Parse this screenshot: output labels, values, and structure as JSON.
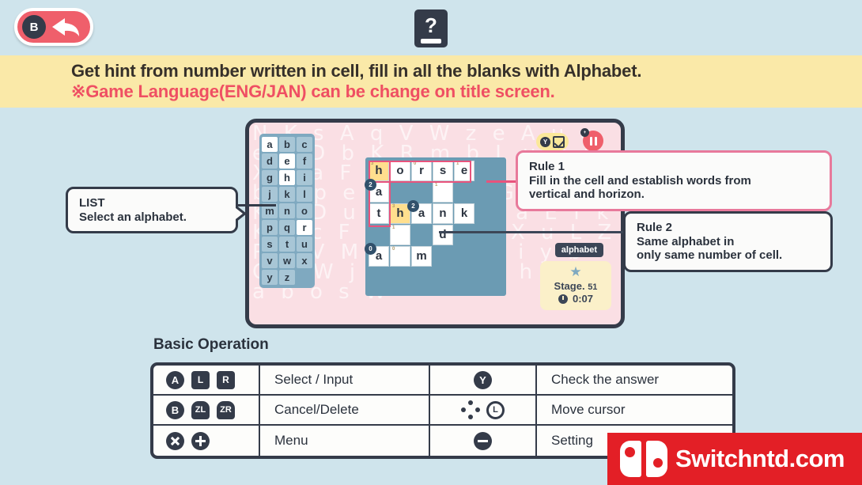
{
  "topbar": {
    "back_button": {
      "button": "B",
      "icon": "back-arrow-icon"
    },
    "help_icon": {
      "glyph": "?",
      "name": "manual-book-icon"
    }
  },
  "banner": {
    "line1": "Get hint from number written in cell, fill in all the blanks with Alphabet.",
    "line2": "※Game Language(ENG/JAN) can be change on title screen.",
    "bg_color": "#fae9a8",
    "line1_color": "#36302a",
    "line2_color": "#ef4f63"
  },
  "game": {
    "bg_letters": "N K s A q V W z e A u o e P D b K R m b L u N j X T a F g R a H Y o u s r b O p e Z m N d G Y i h K 6 D u h L e V o a E f k K q c F o b G P s X u L Z R k V M g Z t h N i y b O a W j D 9 W e J h o T a b o s W",
    "alphabet_list": {
      "letters": [
        "a",
        "b",
        "c",
        "d",
        "e",
        "f",
        "g",
        "h",
        "i",
        "j",
        "k",
        "l",
        "m",
        "n",
        "o",
        "p",
        "q",
        "r",
        "s",
        "t",
        "u",
        "v",
        "w",
        "x",
        "y",
        "z"
      ],
      "used": [
        "a",
        "e",
        "h",
        "r"
      ],
      "title": "alphabet-list"
    },
    "board": {
      "cols": 5,
      "rows": 5,
      "cells": [
        {
          "col": 0,
          "row": 0,
          "letter": "h",
          "num": "3",
          "state": "highlight"
        },
        {
          "col": 1,
          "row": 0,
          "letter": "o",
          "num": "",
          "state": "filled"
        },
        {
          "col": 2,
          "row": 0,
          "letter": "r",
          "num": "0",
          "state": "filled"
        },
        {
          "col": 3,
          "row": 0,
          "letter": "s",
          "num": "",
          "state": "filled"
        },
        {
          "col": 4,
          "row": 0,
          "letter": "e",
          "num": "1",
          "state": "filled"
        },
        {
          "col": 0,
          "row": 1,
          "letter": "a",
          "num": "",
          "state": "filled",
          "marker": "2"
        },
        {
          "col": 3,
          "row": 1,
          "letter": "",
          "num": "1",
          "state": "blank"
        },
        {
          "col": 0,
          "row": 2,
          "letter": "t",
          "num": "",
          "state": "filled"
        },
        {
          "col": 1,
          "row": 2,
          "letter": "h",
          "num": "3",
          "state": "highlight"
        },
        {
          "col": 2,
          "row": 2,
          "letter": "a",
          "num": "",
          "state": "filled",
          "marker": "2"
        },
        {
          "col": 3,
          "row": 2,
          "letter": "n",
          "num": "",
          "state": "filled"
        },
        {
          "col": 4,
          "row": 2,
          "letter": "k",
          "num": "",
          "state": "filled"
        },
        {
          "col": 1,
          "row": 3,
          "letter": "",
          "num": "1",
          "state": "blank"
        },
        {
          "col": 3,
          "row": 3,
          "letter": "d",
          "num": "",
          "state": "filled"
        },
        {
          "col": 0,
          "row": 4,
          "letter": "a",
          "num": "",
          "state": "filled",
          "marker": "0"
        },
        {
          "col": 1,
          "row": 4,
          "letter": "",
          "num": "0",
          "state": "blank"
        },
        {
          "col": 2,
          "row": 4,
          "letter": "m",
          "num": "",
          "state": "filled"
        }
      ],
      "highlight_word": "horse",
      "outline_color": "#e8537c"
    },
    "hud": {
      "check_button": "Y",
      "check_icon": "checkbox-checked-icon",
      "pause_icon": "pause-icon",
      "pause_badge": "+"
    },
    "status": {
      "mode_tag": "alphabet",
      "star_icon": "star-icon",
      "stage_label": "Stage.",
      "stage_number": "51",
      "clock_icon": "clock-icon",
      "time": "0:07"
    }
  },
  "callouts": {
    "list": {
      "title": "LIST",
      "body": "Select an alphabet.",
      "border_color": "#343b49"
    },
    "rule1": {
      "title": "Rule 1",
      "body_line1": "Fill in the cell and establish words from",
      "body_line2": "vertical and horizon.",
      "border_color": "#e8799b"
    },
    "rule2": {
      "title": "Rule 2",
      "body_line1": "Same alphabet in",
      "body_line2": "only same number of cell.",
      "border_color": "#343b49"
    }
  },
  "basic_operation": {
    "title": "Basic Operation",
    "rows": [
      {
        "left_buttons": [
          {
            "label": "A",
            "shape": "round"
          },
          {
            "label": "L",
            "shape": "square"
          },
          {
            "label": "R",
            "shape": "square"
          }
        ],
        "left_action": "Select / Input",
        "right_buttons": [
          {
            "label": "Y",
            "shape": "round"
          }
        ],
        "right_action": "Check the answer"
      },
      {
        "left_buttons": [
          {
            "label": "B",
            "shape": "round"
          },
          {
            "label": "ZL",
            "shape": "trigger"
          },
          {
            "label": "ZR",
            "shape": "trigger"
          }
        ],
        "left_action": "Cancel/Delete",
        "right_buttons": [
          {
            "label": "",
            "shape": "dpad"
          },
          {
            "label": "L",
            "shape": "stick"
          }
        ],
        "right_action": "Move cursor"
      },
      {
        "left_buttons": [
          {
            "label": "X",
            "shape": "x"
          },
          {
            "label": "",
            "shape": "plus"
          }
        ],
        "left_action": "Menu",
        "right_buttons": [
          {
            "label": "",
            "shape": "minus"
          }
        ],
        "right_action": "Setting"
      }
    ]
  },
  "watermark": {
    "text": "Switchntd.com",
    "bg_color": "#e31f26",
    "logo": "nintendo-switch-logo"
  }
}
